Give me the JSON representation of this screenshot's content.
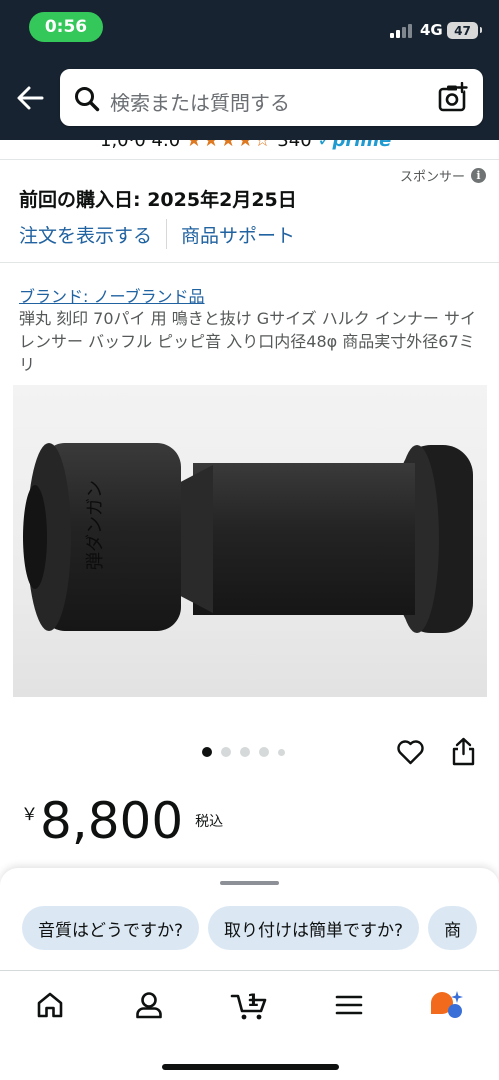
{
  "status_bar": {
    "time": "0:56",
    "network": "4G",
    "battery": "47"
  },
  "header": {
    "search_placeholder": "検索または質問する"
  },
  "peek_row": {
    "text": "1,0·0  4.0 ",
    "stars": "★★★★☆",
    "count": " 340  ",
    "prime": "✓prime"
  },
  "sponsored": {
    "label": "スポンサー",
    "info_icon": "i"
  },
  "order": {
    "purchased_label": "前回の購入日: 2025年2月25日",
    "view_order": "注文を表示する",
    "product_support": "商品サポート"
  },
  "product": {
    "brand": "ブランド: ノーブランド品",
    "title": "弾丸 刻印 70パイ 用 鳴きと抜け Gサイズ ハルク インナー サイレンサー バッフル ピッピ音 入り口内径48φ 商品実寸外径67ミリ",
    "engraving": "弾ダンガン",
    "image_count": 5,
    "active_image": 1,
    "currency": "￥",
    "price": "8,800",
    "tax_label": "税込"
  },
  "suggestions": [
    {
      "label": "音質はどうですか?"
    },
    {
      "label": "取り付けは簡単ですか?"
    },
    {
      "label": "商"
    }
  ],
  "nav": {
    "items": [
      "home-icon",
      "account-icon",
      "cart-icon",
      "menu-icon",
      "rufus-icon"
    ],
    "cart_count": "1"
  },
  "colors": {
    "header": "#172330",
    "link": "#2162a1",
    "chip": "#dbe8f4",
    "time_pill": "#34c759"
  }
}
